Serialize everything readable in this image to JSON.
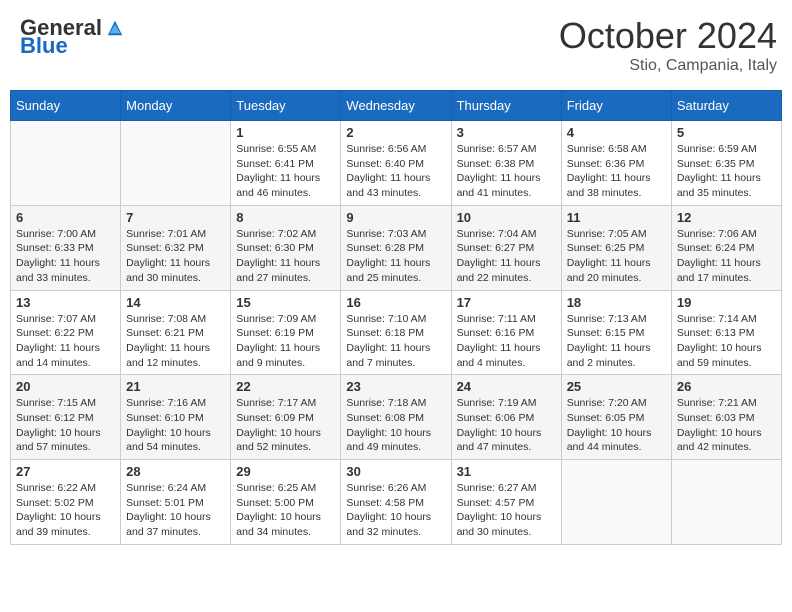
{
  "logo": {
    "general": "General",
    "blue": "Blue"
  },
  "title": {
    "month_year": "October 2024",
    "location": "Stio, Campania, Italy"
  },
  "headers": [
    "Sunday",
    "Monday",
    "Tuesday",
    "Wednesday",
    "Thursday",
    "Friday",
    "Saturday"
  ],
  "weeks": [
    [
      {
        "day": null,
        "info": ""
      },
      {
        "day": null,
        "info": ""
      },
      {
        "day": "1",
        "info": "Sunrise: 6:55 AM\nSunset: 6:41 PM\nDaylight: 11 hours and 46 minutes."
      },
      {
        "day": "2",
        "info": "Sunrise: 6:56 AM\nSunset: 6:40 PM\nDaylight: 11 hours and 43 minutes."
      },
      {
        "day": "3",
        "info": "Sunrise: 6:57 AM\nSunset: 6:38 PM\nDaylight: 11 hours and 41 minutes."
      },
      {
        "day": "4",
        "info": "Sunrise: 6:58 AM\nSunset: 6:36 PM\nDaylight: 11 hours and 38 minutes."
      },
      {
        "day": "5",
        "info": "Sunrise: 6:59 AM\nSunset: 6:35 PM\nDaylight: 11 hours and 35 minutes."
      }
    ],
    [
      {
        "day": "6",
        "info": "Sunrise: 7:00 AM\nSunset: 6:33 PM\nDaylight: 11 hours and 33 minutes."
      },
      {
        "day": "7",
        "info": "Sunrise: 7:01 AM\nSunset: 6:32 PM\nDaylight: 11 hours and 30 minutes."
      },
      {
        "day": "8",
        "info": "Sunrise: 7:02 AM\nSunset: 6:30 PM\nDaylight: 11 hours and 27 minutes."
      },
      {
        "day": "9",
        "info": "Sunrise: 7:03 AM\nSunset: 6:28 PM\nDaylight: 11 hours and 25 minutes."
      },
      {
        "day": "10",
        "info": "Sunrise: 7:04 AM\nSunset: 6:27 PM\nDaylight: 11 hours and 22 minutes."
      },
      {
        "day": "11",
        "info": "Sunrise: 7:05 AM\nSunset: 6:25 PM\nDaylight: 11 hours and 20 minutes."
      },
      {
        "day": "12",
        "info": "Sunrise: 7:06 AM\nSunset: 6:24 PM\nDaylight: 11 hours and 17 minutes."
      }
    ],
    [
      {
        "day": "13",
        "info": "Sunrise: 7:07 AM\nSunset: 6:22 PM\nDaylight: 11 hours and 14 minutes."
      },
      {
        "day": "14",
        "info": "Sunrise: 7:08 AM\nSunset: 6:21 PM\nDaylight: 11 hours and 12 minutes."
      },
      {
        "day": "15",
        "info": "Sunrise: 7:09 AM\nSunset: 6:19 PM\nDaylight: 11 hours and 9 minutes."
      },
      {
        "day": "16",
        "info": "Sunrise: 7:10 AM\nSunset: 6:18 PM\nDaylight: 11 hours and 7 minutes."
      },
      {
        "day": "17",
        "info": "Sunrise: 7:11 AM\nSunset: 6:16 PM\nDaylight: 11 hours and 4 minutes."
      },
      {
        "day": "18",
        "info": "Sunrise: 7:13 AM\nSunset: 6:15 PM\nDaylight: 11 hours and 2 minutes."
      },
      {
        "day": "19",
        "info": "Sunrise: 7:14 AM\nSunset: 6:13 PM\nDaylight: 10 hours and 59 minutes."
      }
    ],
    [
      {
        "day": "20",
        "info": "Sunrise: 7:15 AM\nSunset: 6:12 PM\nDaylight: 10 hours and 57 minutes."
      },
      {
        "day": "21",
        "info": "Sunrise: 7:16 AM\nSunset: 6:10 PM\nDaylight: 10 hours and 54 minutes."
      },
      {
        "day": "22",
        "info": "Sunrise: 7:17 AM\nSunset: 6:09 PM\nDaylight: 10 hours and 52 minutes."
      },
      {
        "day": "23",
        "info": "Sunrise: 7:18 AM\nSunset: 6:08 PM\nDaylight: 10 hours and 49 minutes."
      },
      {
        "day": "24",
        "info": "Sunrise: 7:19 AM\nSunset: 6:06 PM\nDaylight: 10 hours and 47 minutes."
      },
      {
        "day": "25",
        "info": "Sunrise: 7:20 AM\nSunset: 6:05 PM\nDaylight: 10 hours and 44 minutes."
      },
      {
        "day": "26",
        "info": "Sunrise: 7:21 AM\nSunset: 6:03 PM\nDaylight: 10 hours and 42 minutes."
      }
    ],
    [
      {
        "day": "27",
        "info": "Sunrise: 6:22 AM\nSunset: 5:02 PM\nDaylight: 10 hours and 39 minutes."
      },
      {
        "day": "28",
        "info": "Sunrise: 6:24 AM\nSunset: 5:01 PM\nDaylight: 10 hours and 37 minutes."
      },
      {
        "day": "29",
        "info": "Sunrise: 6:25 AM\nSunset: 5:00 PM\nDaylight: 10 hours and 34 minutes."
      },
      {
        "day": "30",
        "info": "Sunrise: 6:26 AM\nSunset: 4:58 PM\nDaylight: 10 hours and 32 minutes."
      },
      {
        "day": "31",
        "info": "Sunrise: 6:27 AM\nSunset: 4:57 PM\nDaylight: 10 hours and 30 minutes."
      },
      {
        "day": null,
        "info": ""
      },
      {
        "day": null,
        "info": ""
      }
    ]
  ]
}
